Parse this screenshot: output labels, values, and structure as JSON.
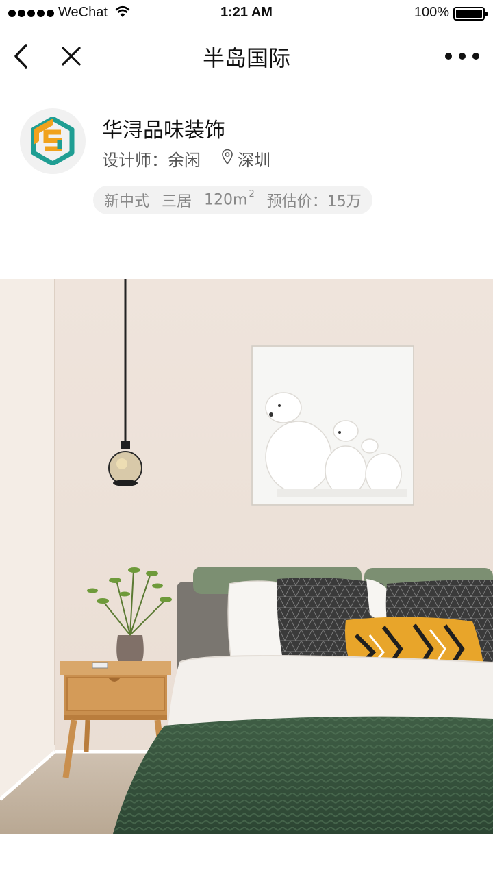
{
  "status_bar": {
    "carrier": "WeChat",
    "time": "1:21 AM",
    "battery": "100%"
  },
  "nav": {
    "title": "半岛国际"
  },
  "company": {
    "name": "华浔品味装饰",
    "designer_label": "设计师：",
    "designer_name": "余闲",
    "location": "深圳"
  },
  "tags": {
    "style": "新中式",
    "rooms": "三居",
    "area": "120m",
    "area_unit_sup": "2",
    "price_label": "预估价：",
    "price": "15万"
  },
  "colors": {
    "logo_orange": "#f0a21c",
    "logo_teal": "#1f9e93",
    "tag_bg": "#f2f2f2",
    "tag_text": "#888888"
  }
}
